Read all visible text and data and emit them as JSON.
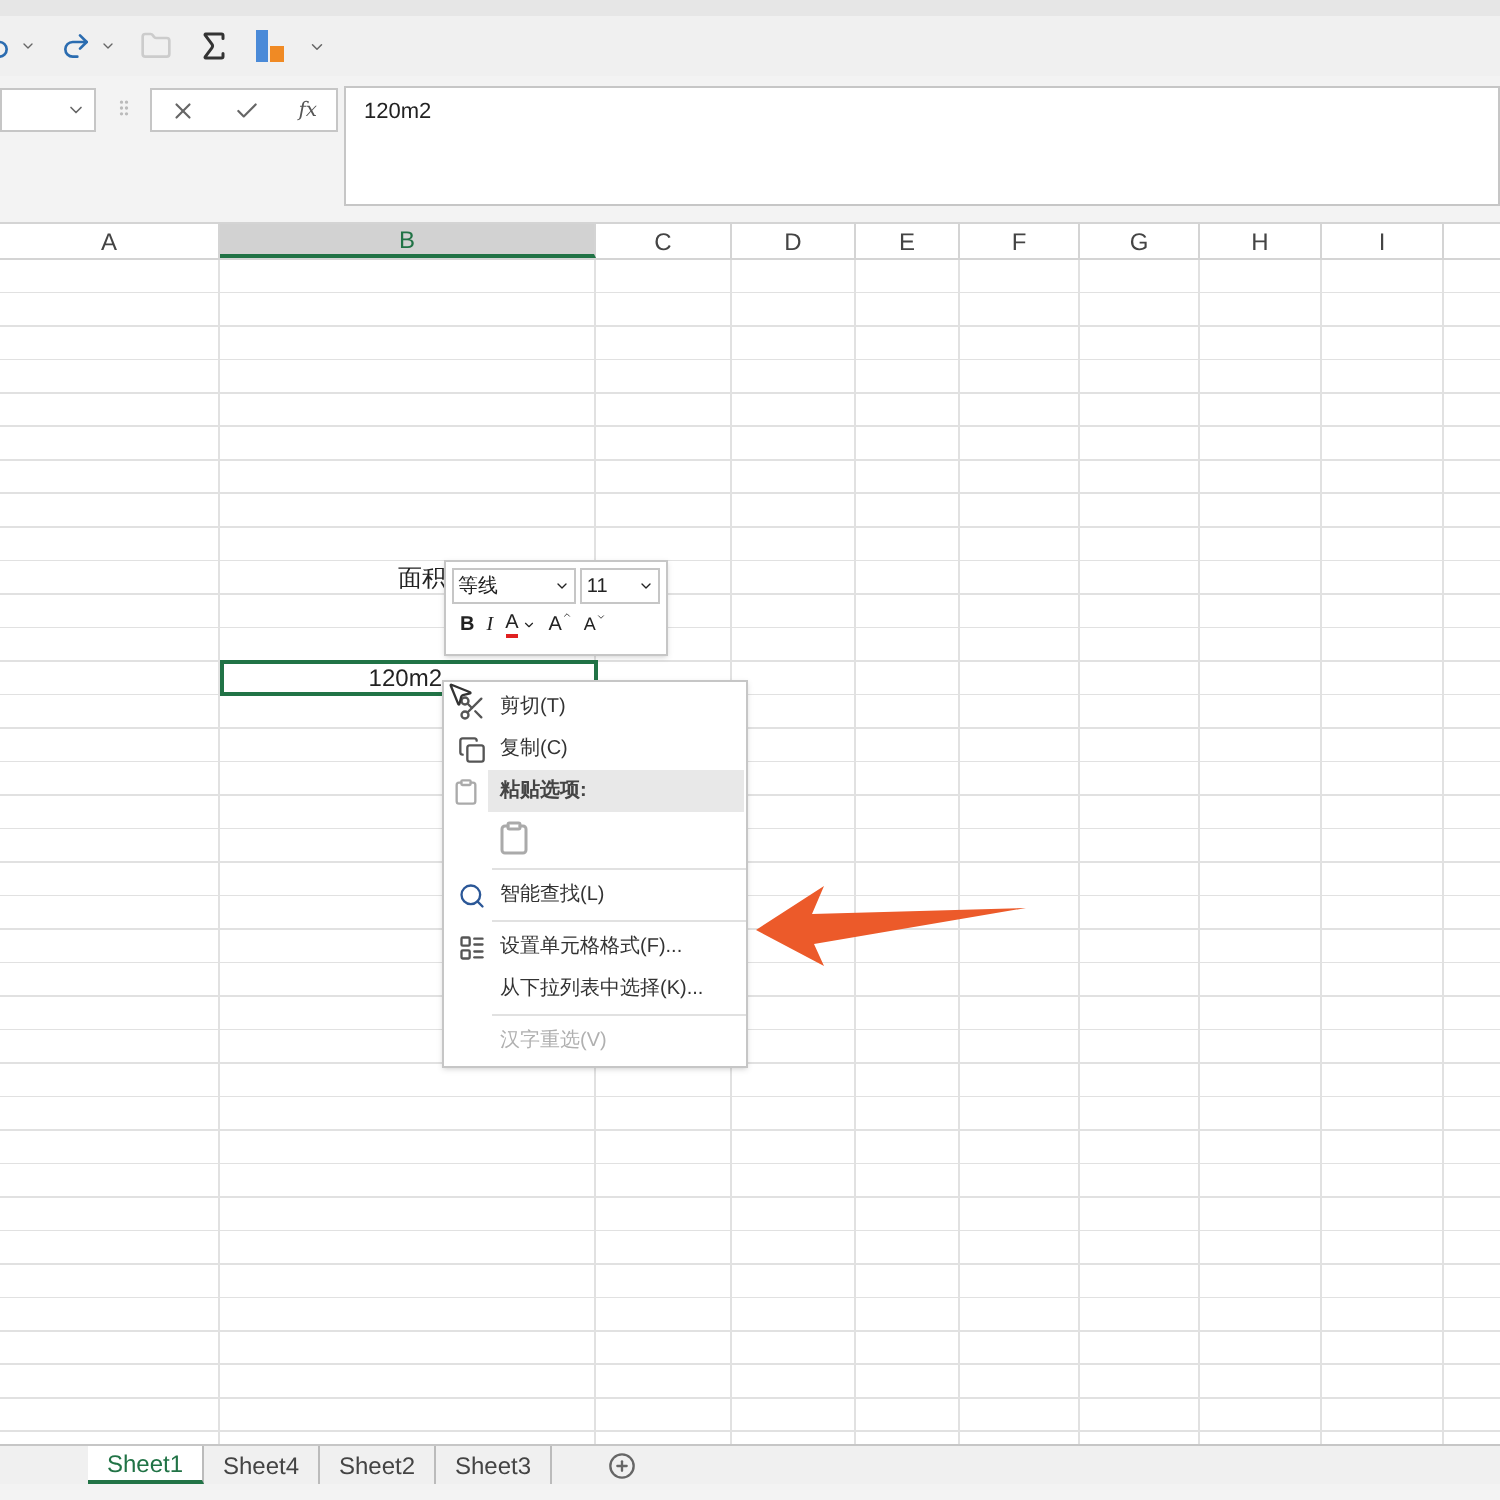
{
  "formula_bar": {
    "value": "120m2",
    "function_label": "fx"
  },
  "columns": [
    {
      "label": "A",
      "selected": false
    },
    {
      "label": "B",
      "selected": true
    },
    {
      "label": "C",
      "selected": false
    },
    {
      "label": "D",
      "selected": false
    },
    {
      "label": "E",
      "selected": false
    },
    {
      "label": "F",
      "selected": false
    },
    {
      "label": "G",
      "selected": false
    },
    {
      "label": "H",
      "selected": false
    },
    {
      "label": "I",
      "selected": false
    }
  ],
  "cells": [
    {
      "text": "面积",
      "selected": false
    },
    {
      "text": "120m2",
      "selected": true
    }
  ],
  "mini_toolbar": {
    "font": "等线",
    "size": "11",
    "bold": "B",
    "italic": "I",
    "font_color": "A",
    "grow": "A",
    "shrink": "A"
  },
  "context_menu": [
    {
      "kind": "cut",
      "label": "剪切(T)",
      "disabled": false
    },
    {
      "kind": "copy",
      "label": "复制(C)",
      "disabled": false
    },
    {
      "kind": "paste_header",
      "label": "粘贴选项:"
    },
    {
      "kind": "paste"
    },
    {
      "kind": "separator"
    },
    {
      "kind": "lookup",
      "label": "智能查找(L)",
      "disabled": false
    },
    {
      "kind": "separator"
    },
    {
      "kind": "format",
      "label": "设置单元格格式(F)...",
      "disabled": false
    },
    {
      "kind": "plain",
      "label": "从下拉列表中选择(K)...",
      "disabled": false
    },
    {
      "kind": "separator"
    },
    {
      "kind": "plain",
      "label": "汉字重选(V)",
      "disabled": true
    }
  ],
  "sheet_tabs": [
    {
      "label": "Sheet1",
      "selected": true
    },
    {
      "label": "Sheet4",
      "selected": false
    },
    {
      "label": "Sheet2",
      "selected": false
    },
    {
      "label": "Sheet3",
      "selected": false
    }
  ]
}
